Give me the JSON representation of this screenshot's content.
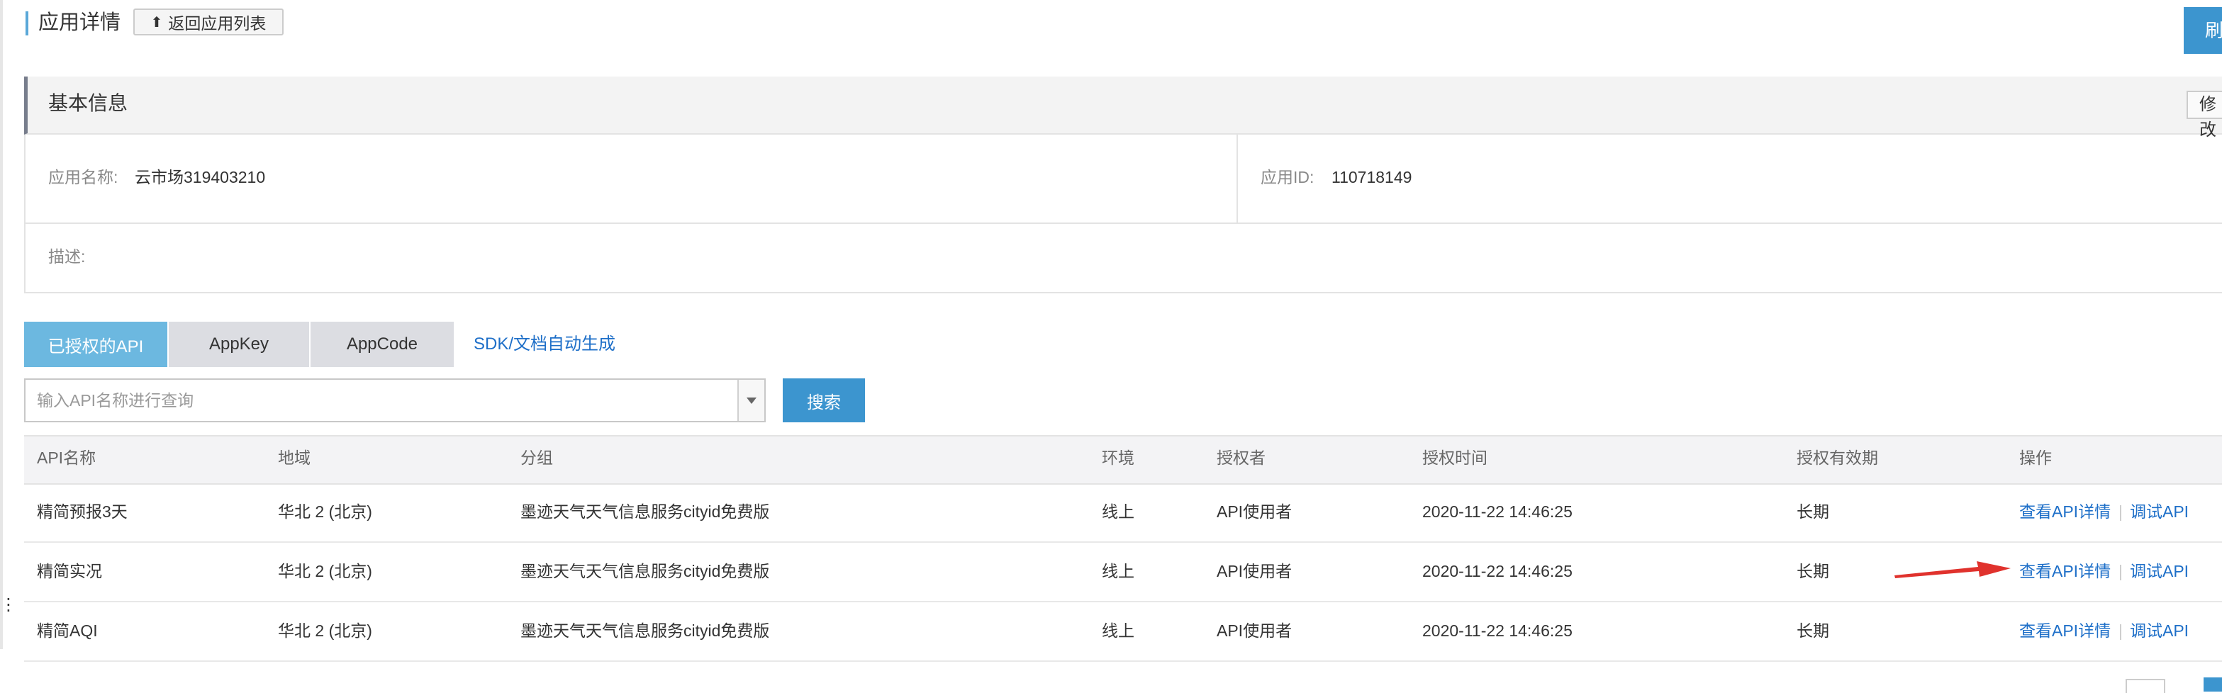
{
  "header": {
    "page_title": "应用详情",
    "back_button_label": "返回应用列表",
    "refresh_button_label": "刷"
  },
  "basic_info": {
    "title": "基本信息",
    "edit_button_label": "修改",
    "app_name_label": "应用名称:",
    "app_name_value": "云市场319403210",
    "app_id_label": "应用ID:",
    "app_id_value": "110718149",
    "description_label": "描述:"
  },
  "tabs": [
    {
      "label": "已授权的API",
      "active": true
    },
    {
      "label": "AppKey",
      "active": false
    },
    {
      "label": "AppCode",
      "active": false
    }
  ],
  "sdk_link_label": "SDK/文档自动生成",
  "search": {
    "placeholder": "输入API名称进行查询",
    "button_label": "搜索"
  },
  "table": {
    "columns": [
      "API名称",
      "地域",
      "分组",
      "环境",
      "授权者",
      "授权时间",
      "授权有效期",
      "操作"
    ],
    "rows": [
      {
        "name": "精简预报3天",
        "region": "华北 2 (北京)",
        "group": "墨迹天气天气信息服务cityid免费版",
        "env": "线上",
        "grantor": "API使用者",
        "time": "2020-11-22 14:46:25",
        "validity": "长期",
        "op_detail": "查看API详情",
        "op_sep": "|",
        "op_debug": "调试API"
      },
      {
        "name": "精简实况",
        "region": "华北 2 (北京)",
        "group": "墨迹天气天气信息服务cityid免费版",
        "env": "线上",
        "grantor": "API使用者",
        "time": "2020-11-22 14:46:25",
        "validity": "长期",
        "op_detail": "查看API详情",
        "op_sep": "|",
        "op_debug": "调试API"
      },
      {
        "name": "精简AQI",
        "region": "华北 2 (北京)",
        "group": "墨迹天气天气信息服务cityid免费版",
        "env": "线上",
        "grantor": "API使用者",
        "time": "2020-11-22 14:46:25",
        "validity": "长期",
        "op_detail": "查看API详情",
        "op_sep": "|",
        "op_debug": "调试API"
      }
    ]
  },
  "colors": {
    "accent_blue": "#3c95cf",
    "active_tab": "#6cb8e0",
    "link_blue": "#1e6fc8",
    "annotation_arrow": "#e0322d"
  }
}
